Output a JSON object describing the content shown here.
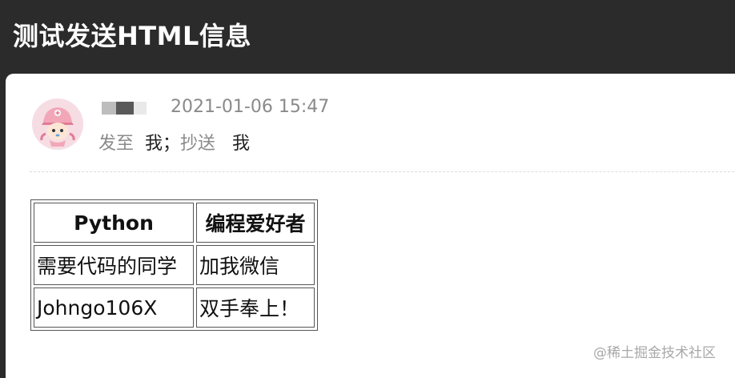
{
  "window": {
    "title": "测试发送HTML信息"
  },
  "email": {
    "sender_name": "",
    "timestamp": "2021-01-06 15:47",
    "to_label": "发至",
    "to_value": "我；",
    "cc_label": "抄送",
    "cc_value": "我"
  },
  "table": {
    "headers": [
      "Python",
      "编程爱好者"
    ],
    "rows": [
      [
        "需要代码的同学",
        "加我微信"
      ],
      [
        "Johngo106X",
        "双手奉上！"
      ]
    ]
  },
  "watermark": "@稀土掘金技术社区",
  "colors": {
    "titlebar_bg": "#2b2b2b",
    "card_bg": "#ffffff",
    "muted_text": "#8a8a8a",
    "avatar_bg": "#f6dde4"
  }
}
